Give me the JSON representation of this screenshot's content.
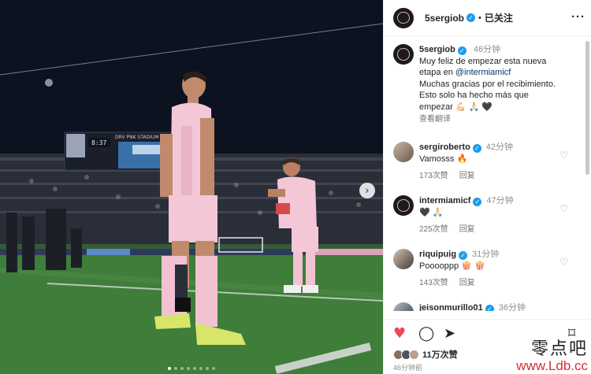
{
  "post": {
    "username": "5sergiob",
    "header_sep": "•",
    "follow_status": "已关注",
    "more_icon": "more-horizontal-icon",
    "caption": {
      "username": "5sergiob",
      "time": "46分钟",
      "line1": "Muy feliz de empezar esta nueva",
      "line2_prefix": "etapa en ",
      "mention": "@intermiamicf",
      "line3": "Muchas gracias por el recibimiento.",
      "line4": "Esto solo ha hecho más que",
      "line5": "empezar 💪🏻 🙏🏻 🖤",
      "translate": "查看翻译"
    }
  },
  "comments": [
    {
      "username": "sergiroberto",
      "time": "42分钟",
      "text": "Vamosss 🔥",
      "likes": "173次赞",
      "reply": "回复"
    },
    {
      "username": "intermiamicf",
      "time": "47分钟",
      "text": "🖤 🙏🏻",
      "likes": "225次赞",
      "reply": "回复"
    },
    {
      "username": "riquipuig",
      "time": "31分钟",
      "text": "Pooooppp 🍿 🍿",
      "likes": "143次赞",
      "reply": "回复"
    },
    {
      "username": "jeisonmurillo01",
      "time": "36分钟",
      "text": "",
      "likes": "",
      "reply": ""
    }
  ],
  "actions": {
    "like_icon": "heart-filled-icon",
    "comment_icon": "comment-icon",
    "share_icon": "send-icon",
    "save_icon": "bookmark-icon",
    "likes_count": "11万次赞",
    "posted_ago": "46分钟前",
    "like_color": "#ed4956"
  },
  "photo": {
    "scoreboard_time": "8:37",
    "stadium_sign": "DRV PNK STADIUM",
    "next_icon": "chevron-right-icon",
    "carousel_count": 8,
    "carousel_active": 0
  },
  "watermark": {
    "chinese": "零点吧",
    "url": "www.Ldb.cc"
  },
  "colors": {
    "accent_blue": "#1d9bf0",
    "pink_kit": "#f3c6d4",
    "watermark_red": "#d32f2f"
  }
}
